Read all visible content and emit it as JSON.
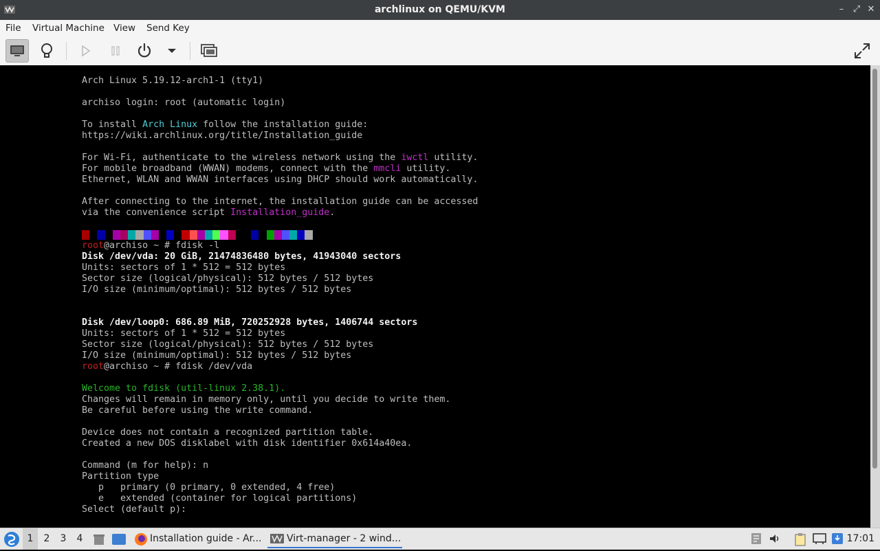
{
  "window": {
    "title": "archlinux on QEMU/KVM",
    "controls": {
      "minimize": "–",
      "maximize": "⤢",
      "close": "✕"
    }
  },
  "menu": [
    "File",
    "Virtual Machine",
    "View",
    "Send Key"
  ],
  "toolbar": {
    "buttons": [
      "console-view",
      "details-view",
      "run",
      "pause",
      "shutdown",
      "shutdown-menu",
      "snapshots",
      "fullscreen"
    ]
  },
  "terminal": {
    "lines": [
      "Arch Linux 5.19.12-arch1-1 (tty1)",
      "",
      "archiso login: root (automatic login)",
      "",
      {
        "parts": [
          "To install ",
          {
            "t": "Arch Linux",
            "c": "cyan"
          },
          " follow the installation guide:"
        ]
      },
      "https://wiki.archlinux.org/title/Installation_guide",
      "",
      {
        "parts": [
          "For Wi-Fi, authenticate to the wireless network using the ",
          {
            "t": "iwctl",
            "c": "mag"
          },
          " utility."
        ]
      },
      {
        "parts": [
          "For mobile broadband (WWAN) modems, connect with the ",
          {
            "t": "mmcli",
            "c": "mag"
          },
          " utility."
        ]
      },
      "Ethernet, WLAN and WWAN interfaces using DHCP should work automatically.",
      "",
      "After connecting to the internet, the installation guide can be accessed",
      {
        "parts": [
          "via the convenience script ",
          {
            "t": "Installation_guide",
            "c": "mag"
          },
          "."
        ]
      },
      "",
      {
        "colorbar": true
      },
      {
        "parts": [
          {
            "t": "root",
            "c": "red"
          },
          "@archiso ~ # fdisk -l"
        ]
      },
      {
        "parts": [
          {
            "t": "Disk /dev/vda: 20 GiB, 21474836480 bytes, 41943040 sectors",
            "c": "bold"
          }
        ]
      },
      "Units: sectors of 1 * 512 = 512 bytes",
      "Sector size (logical/physical): 512 bytes / 512 bytes",
      "I/O size (minimum/optimal): 512 bytes / 512 bytes",
      "",
      "",
      {
        "parts": [
          {
            "t": "Disk /dev/loop0: 686.89 MiB, 720252928 bytes, 1406744 sectors",
            "c": "bold"
          }
        ]
      },
      "Units: sectors of 1 * 512 = 512 bytes",
      "Sector size (logical/physical): 512 bytes / 512 bytes",
      "I/O size (minimum/optimal): 512 bytes / 512 bytes",
      {
        "parts": [
          {
            "t": "root",
            "c": "red"
          },
          "@archiso ~ # fdisk /dev/vda"
        ]
      },
      "",
      {
        "parts": [
          {
            "t": "Welcome to fdisk (util-linux 2.38.1).",
            "c": "green"
          }
        ]
      },
      "Changes will remain in memory only, until you decide to write them.",
      "Be careful before using the write command.",
      "",
      "Device does not contain a recognized partition table.",
      "Created a new DOS disklabel with disk identifier 0x614a40ea.",
      "",
      "Command (m for help): n",
      "Partition type",
      "   p   primary (0 primary, 0 extended, 4 free)",
      "   e   extended (container for logical partitions)",
      "Select (default p): "
    ],
    "colorbar_colors": [
      "#a80000",
      "#000000",
      "#0000a8",
      "#000000",
      "#a800a8",
      "#a80060",
      "#00a8a8",
      "#a8a8a8",
      "#5050ff",
      "#a800a8",
      "#000000",
      "#0000c0",
      "#000000",
      "#c00000",
      "#ff5050",
      "#a800a8",
      "#00a8a8",
      "#50ff50",
      "#ff50ff",
      "#c00050",
      "#000000",
      "#000000",
      "#0000a8",
      "#000000",
      "#00a000",
      "#a800a8",
      "#5050ff",
      "#00a8a8",
      "#0000c0",
      "#a8a8a8"
    ]
  },
  "taskbar": {
    "workspaces": [
      "1",
      "2",
      "3",
      "4"
    ],
    "tasks": [
      {
        "label": "Installation guide - Ar...",
        "icon": "firefox-icon"
      },
      {
        "label": "Virt-manager - 2 wind...",
        "icon": "virt-manager-icon"
      }
    ],
    "clock": "17:01"
  }
}
